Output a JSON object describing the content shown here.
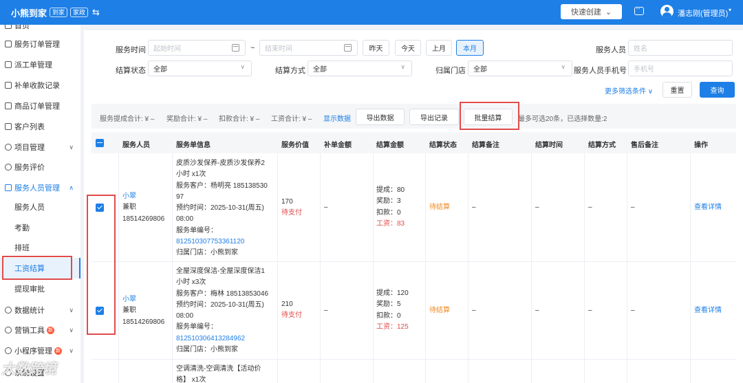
{
  "header": {
    "brand": "小熊到家",
    "tags": [
      "到家",
      "家政"
    ],
    "quick_create": "快速创建",
    "user_name": "潘志刚(管理员)"
  },
  "sidebar": {
    "items": [
      {
        "label": "首页"
      },
      {
        "label": "服务订单管理"
      },
      {
        "label": "派工单管理"
      },
      {
        "label": "补单收款记录"
      },
      {
        "label": "商品订单管理"
      },
      {
        "label": "客户列表"
      },
      {
        "label": "项目管理"
      },
      {
        "label": "服务评价"
      },
      {
        "label": "服务人员管理"
      },
      {
        "label": "数据统计"
      },
      {
        "label": "营销工具"
      },
      {
        "label": "小程序管理"
      },
      {
        "label": "系统设置"
      }
    ],
    "sub_items": [
      {
        "label": "服务人员"
      },
      {
        "label": "考勤"
      },
      {
        "label": "排班"
      },
      {
        "label": "工资结算"
      },
      {
        "label": "提现审批"
      }
    ],
    "badge": "新"
  },
  "filters": {
    "service_time_label": "服务时间",
    "start_placeholder": "起始时间",
    "tilde": "~",
    "end_placeholder": "结束时间",
    "quick_ranges": [
      "昨天",
      "今天",
      "上月",
      "本月"
    ],
    "staff_label": "服务人员",
    "staff_placeholder": "姓名",
    "settle_status_label": "结算状态",
    "settle_status_value": "全部",
    "settle_method_label": "结算方式",
    "settle_method_value": "全部",
    "store_label": "归属门店",
    "store_value": "全部",
    "phone_label": "服务人员手机号",
    "phone_placeholder": "手机号",
    "more_filters": "更多筛选条件",
    "reset": "重置",
    "query": "查询"
  },
  "toolbar": {
    "commission_total": "服务提成合计: ¥ –",
    "reward_total": "奖励合计: ¥ –",
    "deduction_total": "扣款合计: ¥ –",
    "wage_total": "工资合计: ¥ –",
    "show_data": "显示数据",
    "export_data": "导出数据",
    "export_records": "导出记录",
    "batch_settle": "批量结算",
    "selection_info": "最多可选20条，已选择数量:2"
  },
  "table": {
    "headers": [
      "服务人员",
      "服务单信息",
      "服务价值",
      "补单金额",
      "结算金额",
      "结算状态",
      "结算备注",
      "结算时间",
      "结算方式",
      "售后备注",
      "操作"
    ],
    "rows": [
      {
        "staff_name": "小翠",
        "staff_type": "兼职",
        "staff_phone": "18514269806",
        "info_lines": [
          "皮质沙发保养-皮质沙发保养2",
          "小时 x1次",
          "服务客户：杨明亮 185138530",
          "97",
          "预约时间：2025-10-31(周五)",
          "08:00",
          "服务单编号："
        ],
        "order_no": "812510307753361120",
        "store": "归属门店：小熊到家",
        "value": "170",
        "pay_status": "待支付",
        "supplement": "–",
        "commission": "提成：80",
        "reward": "奖励：3",
        "deduction": "扣款：0",
        "wage": "工资：83",
        "settle_status": "待结算",
        "remark": "–",
        "settle_time": "–",
        "settle_method": "–",
        "after_sale": "–",
        "action": "查看详情"
      },
      {
        "staff_name": "小翠",
        "staff_type": "兼职",
        "staff_phone": "18514269806",
        "info_lines": [
          "全屋深度保洁-全屋深度保洁1",
          "小时 x3次",
          "服务客户：梅林 18513853046",
          "预约时间：2025-10-31(周五)",
          "08:00",
          "服务单编号："
        ],
        "order_no": "812510306413284962",
        "store": "归属门店：小熊到家",
        "value": "210",
        "pay_status": "待支付",
        "supplement": "–",
        "commission": "提成：120",
        "reward": "奖励：5",
        "deduction": "扣款：0",
        "wage": "工资：125",
        "settle_status": "待结算",
        "remark": "–",
        "settle_time": "–",
        "settle_method": "–",
        "after_sale": "–",
        "action": "查看详情"
      },
      {
        "info_lines": [
          "空调清洗-空调清洗【活动价",
          "格】 x1次"
        ]
      }
    ]
  },
  "watermark": "大数跨境",
  "colors": {
    "primary": "#1e7fe6",
    "highlight_box": "#e14a4a",
    "pending": "#f08a24",
    "wage": "#e14a4a"
  }
}
